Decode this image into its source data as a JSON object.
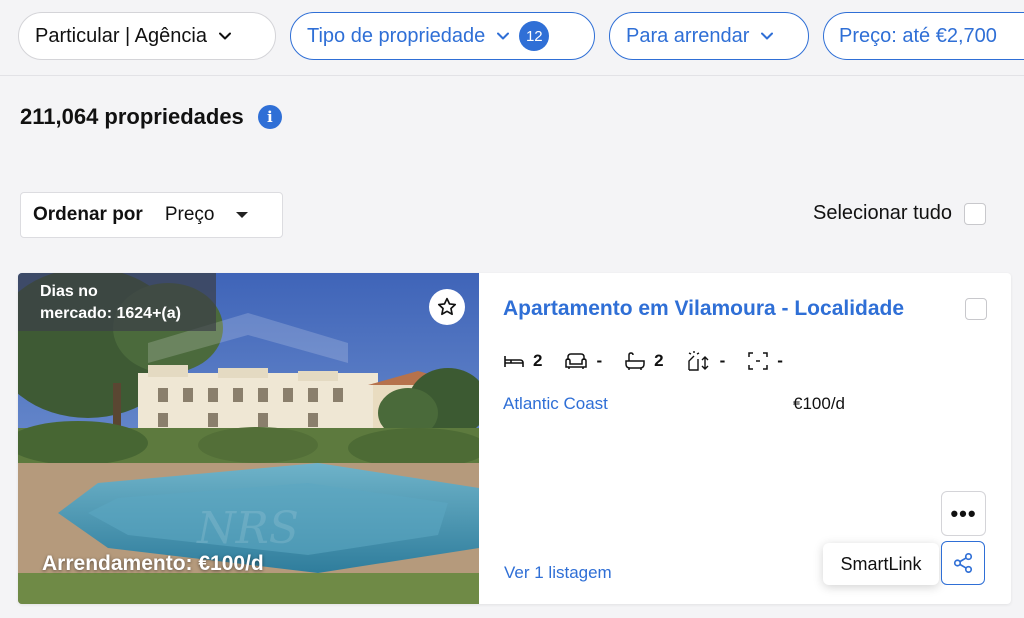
{
  "filters": {
    "owner_type": "Particular | Agência",
    "property_type": "Tipo de propriedade",
    "property_type_count": "12",
    "operation": "Para arrendar",
    "price": "Preço: até €2,700"
  },
  "results": {
    "count_label": "211,064 propriedades",
    "info_icon": "i"
  },
  "sort": {
    "label": "Ordenar por",
    "value": "Preço"
  },
  "select_all_label": "Selecionar tudo",
  "listing": {
    "days_on_market_line1": "Dias no",
    "days_on_market_line2": "mercado: 1624+(a)",
    "rent_price": "Arrendamento: €100/d",
    "title": "Apartamento em Vilamoura - Localidade",
    "bedrooms": "2",
    "living_rooms": "-",
    "bathrooms": "2",
    "floors": "-",
    "area": "-",
    "location": "Atlantic Coast",
    "price_per_day": "€100/d",
    "listings_link": "Ver 1 listagem",
    "more_label": "•••",
    "smartlink_tooltip": "SmartLink"
  },
  "icons": [
    "chevron-down-icon",
    "info-icon",
    "caret-down-icon",
    "star-icon",
    "bed-icon",
    "sofa-icon",
    "bathtub-icon",
    "floors-icon",
    "area-icon",
    "share-icon"
  ],
  "colors": {
    "accent": "#2f6fd6",
    "background": "#f4f4f6"
  }
}
